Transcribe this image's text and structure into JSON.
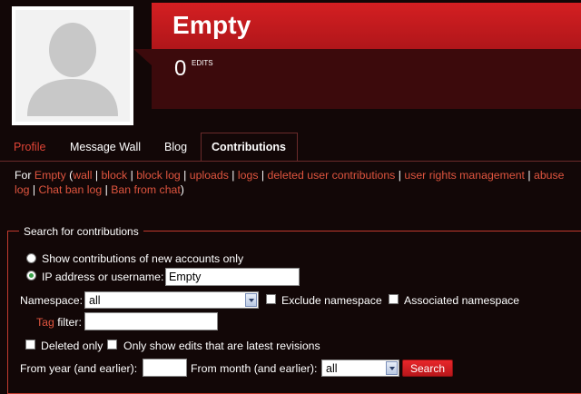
{
  "user": {
    "title": "Empty",
    "edit_count": "0",
    "edits_label": "EDITS"
  },
  "tabs": [
    {
      "label": "Profile"
    },
    {
      "label": "Message Wall"
    },
    {
      "label": "Blog"
    },
    {
      "label": "Contributions"
    }
  ],
  "links": {
    "prefix": "For",
    "user": "Empty",
    "wall": "wall",
    "block": "block",
    "block_log": "block log",
    "uploads": "uploads",
    "logs": "logs",
    "deleted_contribs": "deleted user contributions",
    "user_rights": "user rights management",
    "abuse_log": "abuse log",
    "chat_ban_log": "Chat ban log",
    "ban_from_chat": "Ban from chat"
  },
  "form": {
    "legend": "Search for contributions",
    "radio_new_accounts": "Show contributions of new accounts only",
    "radio_ip_user": "IP address or username:",
    "username_value": "Empty",
    "namespace_label": "Namespace:",
    "namespace_value": "all",
    "exclude_namespace": "Exclude namespace",
    "associated_namespace": "Associated namespace",
    "tag_word": "Tag",
    "filter_word": "filter:",
    "tag_filter_value": "",
    "deleted_only": "Deleted only",
    "latest_revisions": "Only show edits that are latest revisions",
    "from_year_label": "From year (and earlier):",
    "from_year_value": "",
    "from_month_label": "From month (and earlier):",
    "month_value": "all",
    "search_button": "Search"
  },
  "colors": {
    "brand_red": "#d41f22",
    "link": "#e0553f",
    "background": "#120707"
  }
}
